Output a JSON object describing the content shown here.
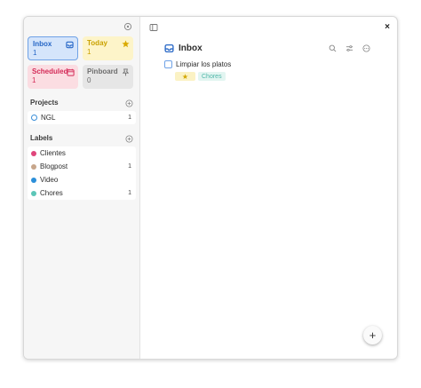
{
  "sidebar": {
    "tiles": {
      "inbox": {
        "label": "Inbox",
        "count": "1"
      },
      "today": {
        "label": "Today",
        "count": "1"
      },
      "scheduled": {
        "label": "Scheduled",
        "count": "1"
      },
      "pinboard": {
        "label": "Pinboard",
        "count": "0"
      }
    },
    "projects": {
      "title": "Projects",
      "items": [
        {
          "name": "NGL",
          "count": "1"
        }
      ]
    },
    "labels": {
      "title": "Labels",
      "items": [
        {
          "name": "Clientes",
          "count": "",
          "color": "#e0457b"
        },
        {
          "name": "Blogpost",
          "count": "1",
          "color": "#c7a68b"
        },
        {
          "name": "Video",
          "count": "",
          "color": "#2b8fd9"
        },
        {
          "name": "Chores",
          "count": "1",
          "color": "#5cc6b8"
        }
      ]
    }
  },
  "main": {
    "title": "Inbox",
    "tasks": [
      {
        "title": "Limpiar los platos",
        "label": "Chores"
      }
    ],
    "close_glyph": "×",
    "add_glyph": "+"
  },
  "colors": {
    "accent": "#2767c6",
    "today": "#c9a100",
    "scheduled": "#d42b58"
  }
}
